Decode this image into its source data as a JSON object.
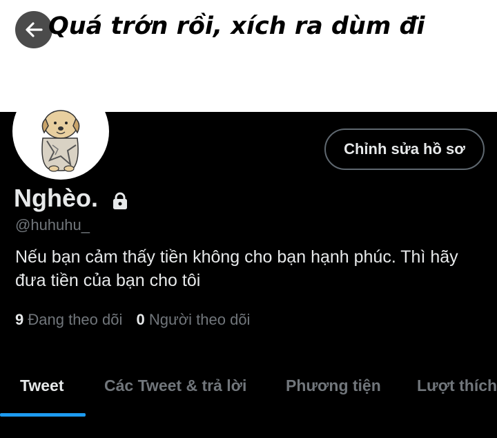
{
  "banner": {
    "caption": "Quá trớn rồi, xích ra dùm đi"
  },
  "header": {
    "back_icon": "arrow-left-icon"
  },
  "profile": {
    "edit_button_label": "Chỉnh sửa hồ sơ",
    "display_name": "Nghèo.",
    "protected_icon": "lock-icon",
    "handle": "@huhuhu_",
    "bio": "Nếu bạn cảm thấy tiền không cho bạn hạnh phúc. Thì hãy đưa tiền của bạn cho tôi",
    "following_count": "9",
    "following_label": "Đang theo dõi",
    "followers_count": "0",
    "followers_label": "Người theo dõi"
  },
  "tabs": [
    {
      "label": "Tweet",
      "active": true
    },
    {
      "label": "Các Tweet & trả lời",
      "active": false
    },
    {
      "label": "Phương tiện",
      "active": false
    },
    {
      "label": "Lượt thích",
      "active": false
    }
  ],
  "colors": {
    "background": "#000000",
    "accent": "#1d9bf0",
    "secondary_text": "#71767b",
    "primary_text": "#e7e9ea"
  }
}
